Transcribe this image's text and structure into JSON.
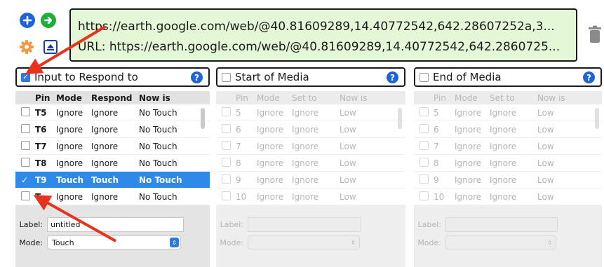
{
  "url": {
    "line1": "https://earth.google.com/web/@40.81609289,14.40772542,642.28607252a,3...",
    "line2": "URL: https://earth.google.com/web/@40.81609289,14.40772542,642.2860725..."
  },
  "toolbar": {
    "add_icon": "plus-icon",
    "go_icon": "arrow-right-icon",
    "settings_icon": "gear-icon",
    "present_icon": "present-icon",
    "trash_icon": "trash-icon"
  },
  "panels": {
    "input": {
      "title": "Input to Respond to",
      "checked": true,
      "help": "?",
      "columns": [
        "Pin",
        "Mode",
        "Respond",
        "Now is"
      ],
      "rows": [
        {
          "pin": "T5",
          "mode": "Ignore",
          "respond": "Ignore",
          "now": "No Touch",
          "checked": false
        },
        {
          "pin": "T6",
          "mode": "Ignore",
          "respond": "Ignore",
          "now": "No Touch",
          "checked": false
        },
        {
          "pin": "T7",
          "mode": "Ignore",
          "respond": "Ignore",
          "now": "No Touch",
          "checked": false
        },
        {
          "pin": "T8",
          "mode": "Ignore",
          "respond": "Ignore",
          "now": "No Touch",
          "checked": false
        },
        {
          "pin": "T9",
          "mode": "Touch",
          "respond": "Touch",
          "now": "No Touch",
          "checked": true
        },
        {
          "pin": "T",
          "mode": "Ignore",
          "respond": "Ignore",
          "now": "No Touch",
          "checked": false
        }
      ],
      "label_label": "Label:",
      "label_value": "untitled",
      "mode_label": "Mode:",
      "mode_value": "Touch"
    },
    "start": {
      "title": "Start of Media",
      "checked": false,
      "help": "?",
      "columns": [
        "Pin",
        "Mode",
        "Set to",
        "Now is"
      ],
      "rows": [
        {
          "pin": "5",
          "mode": "Ignore",
          "set": "Ignore",
          "now": "Low"
        },
        {
          "pin": "6",
          "mode": "Ignore",
          "set": "Ignore",
          "now": "Low"
        },
        {
          "pin": "7",
          "mode": "Ignore",
          "set": "Ignore",
          "now": "Low"
        },
        {
          "pin": "8",
          "mode": "Ignore",
          "set": "Ignore",
          "now": "Low"
        },
        {
          "pin": "9",
          "mode": "Ignore",
          "set": "Ignore",
          "now": "Low"
        },
        {
          "pin": "10",
          "mode": "Ignore",
          "set": "Ignore",
          "now": "Low"
        }
      ],
      "label_label": "Label:",
      "mode_label": "Mode:"
    },
    "end": {
      "title": "End of Media",
      "checked": false,
      "help": "?",
      "columns": [
        "Pin",
        "Mode",
        "Set to",
        "Now is"
      ],
      "rows": [
        {
          "pin": "5",
          "mode": "Ignore",
          "set": "Ignore",
          "now": "Low"
        },
        {
          "pin": "6",
          "mode": "Ignore",
          "set": "Ignore",
          "now": "Low"
        },
        {
          "pin": "7",
          "mode": "Ignore",
          "set": "Ignore",
          "now": "Low"
        },
        {
          "pin": "8",
          "mode": "Ignore",
          "set": "Ignore",
          "now": "Low"
        },
        {
          "pin": "9",
          "mode": "Ignore",
          "set": "Ignore",
          "now": "Low"
        },
        {
          "pin": "10",
          "mode": "Ignore",
          "set": "Ignore",
          "now": "Low"
        }
      ],
      "label_label": "Label:",
      "mode_label": "Mode:"
    }
  },
  "colors": {
    "url_bg": "#e4f7d6",
    "selection": "#2f89e8",
    "annotation_arrow": "#e8331c",
    "help_blue": "#1d64d8"
  }
}
